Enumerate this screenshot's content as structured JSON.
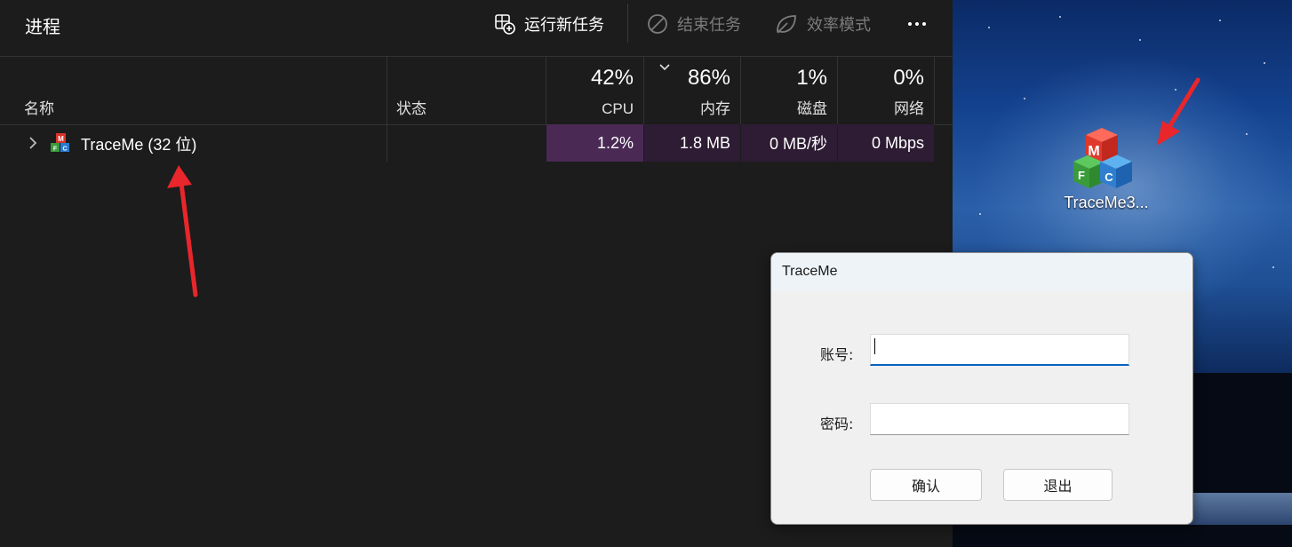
{
  "task_manager": {
    "title": "进程",
    "toolbar": {
      "run_new_task": "运行新任务",
      "end_task": "结束任务",
      "efficiency_mode": "效率模式"
    },
    "columns": {
      "name": "名称",
      "status": "状态",
      "cpu": {
        "percent": "42%",
        "label": "CPU"
      },
      "memory": {
        "percent": "86%",
        "label": "内存"
      },
      "disk": {
        "percent": "1%",
        "label": "磁盘"
      },
      "network": {
        "percent": "0%",
        "label": "网络"
      }
    },
    "processes": [
      {
        "name": "TraceMe (32 位)",
        "status": "",
        "cpu": "1.2%",
        "memory": "1.8 MB",
        "disk": "0 MB/秒",
        "network": "0 Mbps"
      }
    ]
  },
  "desktop": {
    "icon_label": "TraceMe3..."
  },
  "dialog": {
    "title": "TraceMe",
    "account_label": "账号:",
    "password_label": "密码:",
    "account_value": "",
    "password_value": "",
    "ok_button": "确认",
    "exit_button": "退出"
  },
  "colors": {
    "cpu_heat": "#4a2a55",
    "row_heat": "#2d1c33",
    "annotation_arrow": "#e8262b",
    "focus_underline": "#0a63c2"
  }
}
